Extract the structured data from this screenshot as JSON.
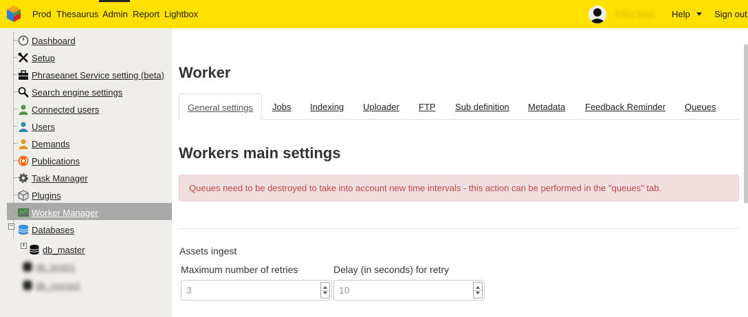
{
  "topnav": {
    "items": [
      "Prod",
      "Thesaurus",
      "Admin",
      "Report",
      "Lightbox"
    ],
    "active": "Admin",
    "username": "Félix Noix",
    "help_label": "Help",
    "signout_label": "Sign out"
  },
  "sidebar": {
    "items": [
      {
        "label": "Dashboard",
        "icon": "dashboard-icon"
      },
      {
        "label": "Setup",
        "icon": "tools-icon"
      },
      {
        "label": "Phraseanet Service setting (beta)",
        "icon": "toolbox-icon"
      },
      {
        "label": "Search engine settings",
        "icon": "magnifier-icon"
      },
      {
        "label": "Connected users",
        "icon": "user-green-icon"
      },
      {
        "label": "Users",
        "icon": "user-teal-icon"
      },
      {
        "label": "Demands",
        "icon": "user-orange-icon"
      },
      {
        "label": "Publications",
        "icon": "rss-icon"
      },
      {
        "label": "Task Manager",
        "icon": "gear-icon"
      },
      {
        "label": "Plugins",
        "icon": "cube-icon"
      },
      {
        "label": "Worker Manager",
        "icon": "worker-icon"
      },
      {
        "label": "Databases",
        "icon": "database-icon"
      }
    ],
    "selected": "Worker Manager",
    "databases": [
      {
        "label": "db_master"
      },
      {
        "label": "db_test01"
      },
      {
        "label": "db_morse2"
      }
    ]
  },
  "main": {
    "title": "Worker",
    "tabs": [
      "General settings",
      "Jobs",
      "Indexing",
      "Uploader",
      "FTP",
      "Sub definition",
      "Metadata",
      "Feedback Reminder",
      "Queues"
    ],
    "active_tab": "General settings",
    "section_title": "Workers main settings",
    "alert": "Queues need to be destroyed to take into account new time intervals - this action can be performed in the \"queues\" tab.",
    "assets_ingest": {
      "label": "Assets ingest",
      "max_retries_label": "Maximum number of retries",
      "max_retries_value": "3",
      "delay_label": "Delay (in seconds) for retry",
      "delay_value": "10"
    }
  },
  "colors": {
    "topbar": "#ffe000",
    "sidebar_bg": "#f0eeea",
    "selected_bg": "#a9a9a9",
    "alert_bg": "#f2dede",
    "alert_text": "#b94a48"
  }
}
